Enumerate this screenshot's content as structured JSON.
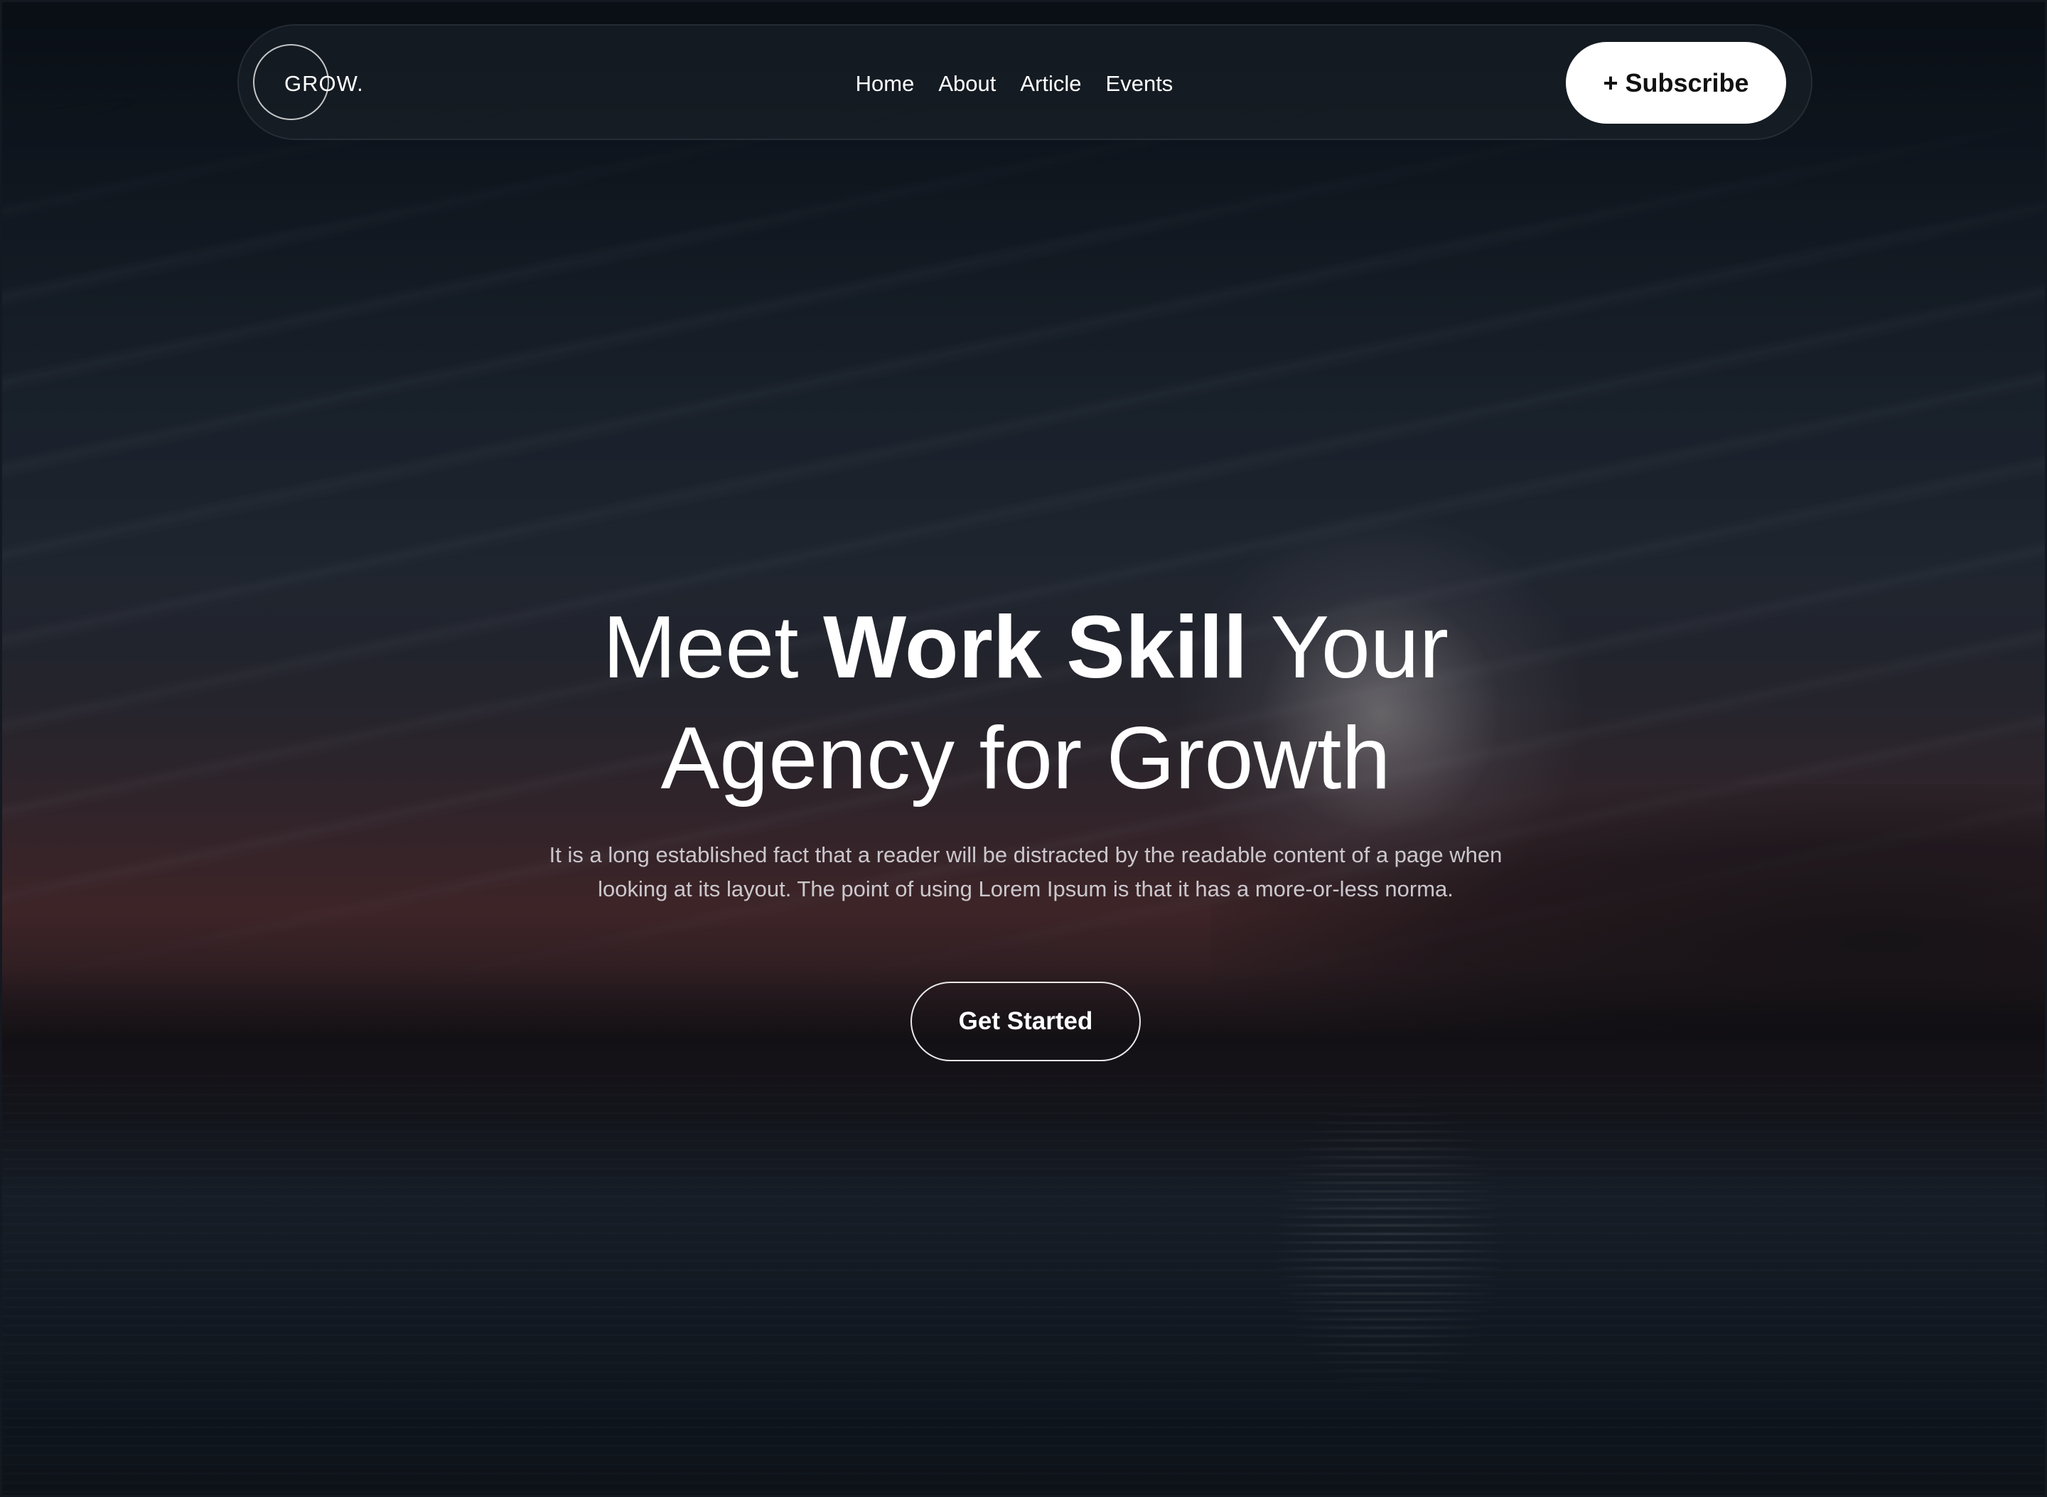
{
  "brand": {
    "logo_text": "GROW."
  },
  "nav": {
    "links": [
      "Home",
      "About",
      "Article",
      "Events"
    ],
    "subscribe_label": "+ Subscribe"
  },
  "hero": {
    "title_pre": "Meet ",
    "title_bold": "Work Skill",
    "title_post": " Your",
    "title_line2": "Agency for Growth",
    "subtitle": "It is a long established fact that a reader will be distracted by the readable content of a page when looking at its layout. The point of using Lorem Ipsum is that it has a more-or-less norma.",
    "cta_label": "Get Started"
  },
  "colors": {
    "accent_button": "#ffffff",
    "text": "#ffffff",
    "background": "#141b24"
  }
}
